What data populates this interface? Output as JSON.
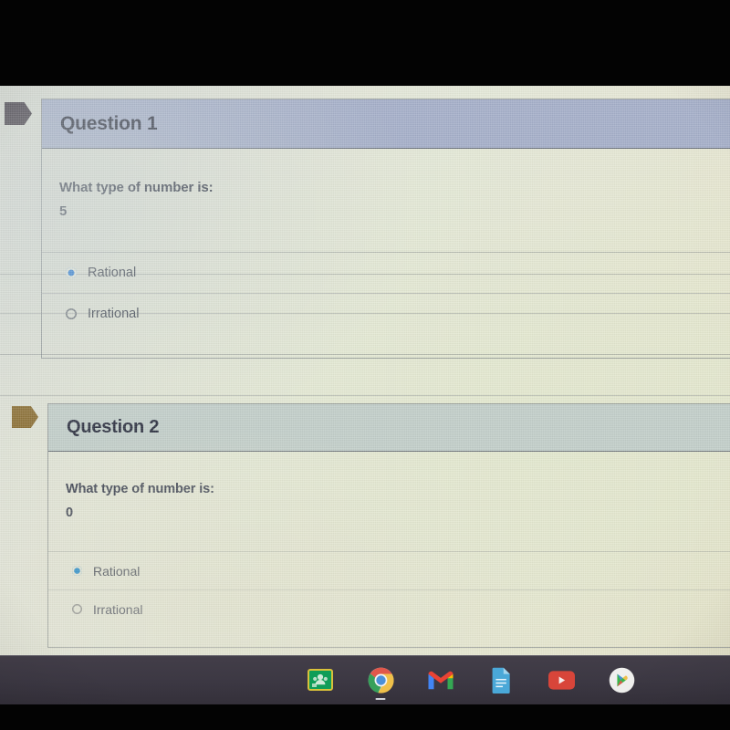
{
  "screen": {
    "device": "chromebook-screen-photo",
    "background_color": "#e3e6d6"
  },
  "quiz": {
    "questions": [
      {
        "id": "q1",
        "title": "Question 1",
        "prompt": "What type of number is:",
        "value": "5",
        "header_color": "#a5afc9",
        "flag_color": "#413a44",
        "options": [
          {
            "label": "Rational",
            "selected": true
          },
          {
            "label": "Irrational",
            "selected": false
          }
        ]
      },
      {
        "id": "q2",
        "title": "Question 2",
        "prompt": "What type of number is:",
        "value": "0",
        "header_color": "#c2cec9",
        "flag_color": "#8a6d31",
        "options": [
          {
            "label": "Rational",
            "selected": true
          },
          {
            "label": "Irrational",
            "selected": false
          }
        ]
      }
    ],
    "selected_radio_color": "#1a73d4",
    "unselected_radio_color": "#6a7077"
  },
  "shelf": {
    "background_color": "#3c3843",
    "items": [
      {
        "name": "google-classroom-icon",
        "label": "Google Classroom",
        "active": false
      },
      {
        "name": "chrome-icon",
        "label": "Google Chrome",
        "active": true
      },
      {
        "name": "gmail-icon",
        "label": "Gmail",
        "active": false
      },
      {
        "name": "google-docs-icon",
        "label": "Google Docs",
        "active": false
      },
      {
        "name": "youtube-icon",
        "label": "YouTube",
        "active": false
      },
      {
        "name": "google-play-icon",
        "label": "Google Play Store",
        "active": false
      }
    ]
  }
}
